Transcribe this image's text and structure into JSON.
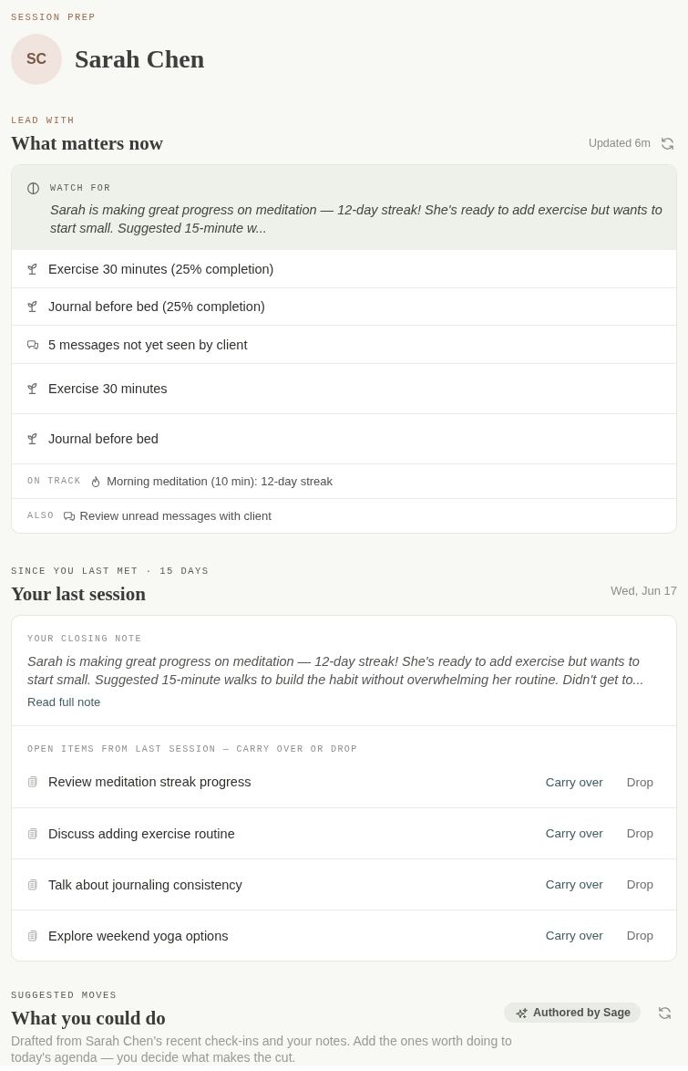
{
  "header": {
    "eyebrow": "SESSION PREP",
    "initials": "SC",
    "name": "Sarah Chen"
  },
  "lead_with": {
    "eyebrow": "LEAD WITH",
    "title": "What matters now",
    "updated": "Updated 6m",
    "watch_for": {
      "label": "WATCH FOR",
      "text": "Sarah is making great progress on meditation — 12-day streak! She's ready to add exercise but wants to start small. Suggested 15-minute w..."
    },
    "items": [
      {
        "kind": "habit_progress",
        "text": "Exercise 30 minutes (25% completion)"
      },
      {
        "kind": "habit_progress",
        "text": "Journal before bed (25% completion)"
      },
      {
        "kind": "message",
        "text": "5 messages not yet seen by client"
      },
      {
        "kind": "habit",
        "text": "Exercise 30 minutes"
      },
      {
        "kind": "habit",
        "text": "Journal before bed"
      }
    ],
    "notes": [
      {
        "label": "ON TRACK",
        "kind": "streak",
        "text": "Morning meditation (10 min): 12-day streak"
      },
      {
        "label": "ALSO",
        "kind": "message",
        "text": "Review unread messages with client"
      }
    ]
  },
  "last_session": {
    "eyebrow": "SINCE YOU LAST MET · 15 DAYS",
    "title": "Your last session",
    "date": "Wed, Jun 17",
    "closing_note": {
      "label": "YOUR CLOSING NOTE",
      "text": "Sarah is making great progress on meditation — 12-day streak! She's ready to add exercise but wants to start small. Suggested 15-minute walks to build the habit without overwhelming her routine. Didn't get to...",
      "link": "Read full note"
    },
    "open_items": {
      "label": "OPEN ITEMS FROM LAST SESSION — CARRY OVER OR DROP",
      "items": [
        {
          "text": "Review meditation streak progress",
          "carry": "Carry over",
          "drop": "Drop"
        },
        {
          "text": "Discuss adding exercise routine",
          "carry": "Carry over",
          "drop": "Drop"
        },
        {
          "text": "Talk about journaling consistency",
          "carry": "Carry over",
          "drop": "Drop"
        },
        {
          "text": "Explore weekend yoga options",
          "carry": "Carry over",
          "drop": "Drop"
        }
      ]
    }
  },
  "suggested_moves": {
    "eyebrow": "SUGGESTED MOVES",
    "title": "What you could do",
    "badge": "Authored by Sage",
    "description": "Drafted from Sarah Chen's recent check-ins and your notes. Add the ones worth doing to today's agenda — you decide what makes the cut."
  }
}
